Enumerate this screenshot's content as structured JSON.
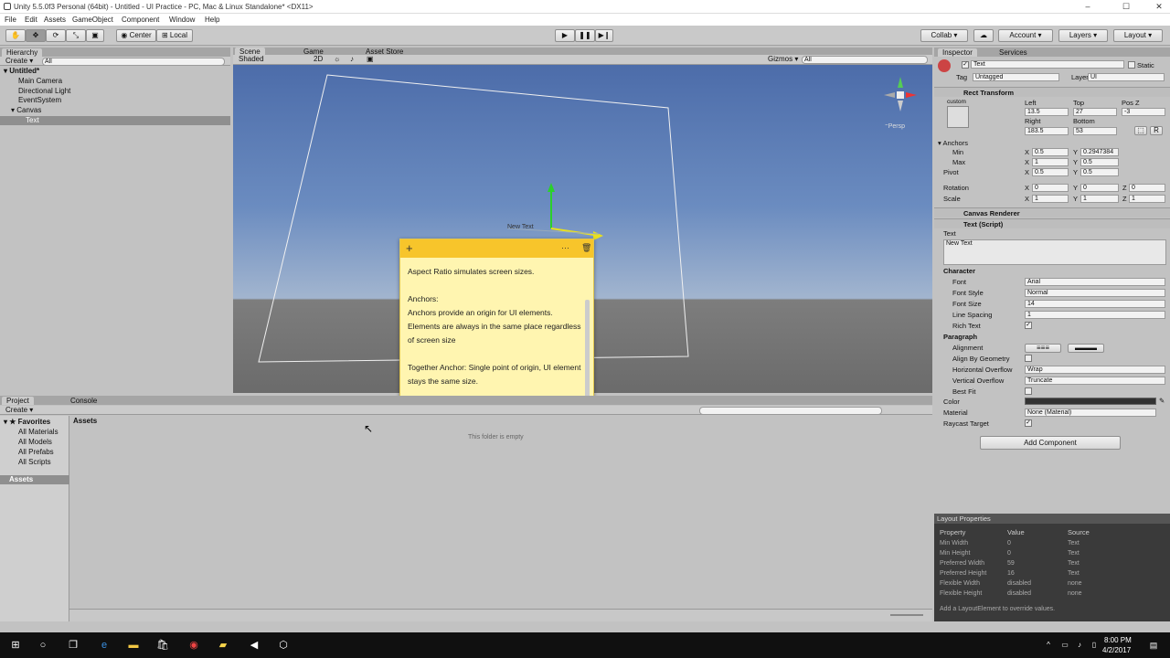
{
  "window": {
    "title": "Unity 5.5.0f3 Personal (64bit) - Untitled - UI Practice - PC, Mac & Linux Standalone* <DX11>"
  },
  "menu": [
    "File",
    "Edit",
    "Assets",
    "GameObject",
    "Component",
    "Window",
    "Help"
  ],
  "toolbar": {
    "pivot_center": "Center",
    "pivot_local": "Local",
    "collab": "Collab ▾",
    "account": "Account",
    "layers": "Layers",
    "layout": "Layout"
  },
  "hierarchy": {
    "tab": "Hierarchy",
    "create": "Create ▾",
    "search_placeholder": "All",
    "scene": "Untitled*",
    "items": [
      "Main Camera",
      "Directional Light",
      "EventSystem",
      "Canvas",
      "Text"
    ]
  },
  "scene_view": {
    "tabs": [
      "Scene",
      "Game",
      "Asset Store"
    ],
    "shading": "Shaded",
    "mode_2d": "2D",
    "gizmos": "Gizmos ▾",
    "search_placeholder": "All",
    "persp_label": "Persp",
    "object_label": "New Text"
  },
  "sticky_note": {
    "text": "Aspect Ratio simulates screen sizes.\n\nAnchors:\nAnchors provide an origin for UI elements. Elements are always in the same place regardless of screen size\n\nTogether Anchor: Single point of origin, UI element stays the same size.\n\nSplit Anchors: Organize UI elements inside a zone, resi"
  },
  "project": {
    "tabs": [
      "Project",
      "Console"
    ],
    "create": "Create ▾",
    "favorites_label": "Favorites",
    "favorites": [
      "All Materials",
      "All Models",
      "All Prefabs",
      "All Scripts"
    ],
    "assets_label": "Assets",
    "breadcrumb": "Assets",
    "empty_text": "This folder is empty"
  },
  "inspector": {
    "tabs": [
      "Inspector",
      "Services"
    ],
    "object_name": "Text",
    "static_label": "Static",
    "tag_label": "Tag",
    "tag_value": "Untagged",
    "layer_label": "Layer",
    "layer_value": "UI",
    "rect_transform": {
      "title": "Rect Transform",
      "custom": "custom",
      "left_label": "Left",
      "left": "13.5",
      "top_label": "Top",
      "top": "27",
      "posz_label": "Pos Z",
      "posz": "-3",
      "right_label": "Right",
      "right": "183.5",
      "bottom_label": "Bottom",
      "bottom": "53",
      "r_button": "R",
      "anchors_label": "Anchors",
      "min_label": "Min",
      "min_x": "0.5",
      "min_y": "0.2947384",
      "max_label": "Max",
      "max_x": "1",
      "max_y": "0.5",
      "pivot_label": "Pivot",
      "pivot_x": "0.5",
      "pivot_y": "0.5",
      "rotation_label": "Rotation",
      "rot_x": "0",
      "rot_y": "0",
      "rot_z": "0",
      "scale_label": "Scale",
      "scale_x": "1",
      "scale_y": "1",
      "scale_z": "1",
      "x": "X",
      "y": "Y",
      "z": "Z"
    },
    "canvas_renderer": {
      "title": "Canvas Renderer"
    },
    "text_script": {
      "title": "Text (Script)",
      "text_label": "Text",
      "text_value": "New Text",
      "character_label": "Character",
      "font_label": "Font",
      "font_value": "Arial",
      "font_style_label": "Font Style",
      "font_style_value": "Normal",
      "font_size_label": "Font Size",
      "font_size_value": "14",
      "line_spacing_label": "Line Spacing",
      "line_spacing_value": "1",
      "rich_text_label": "Rich Text",
      "paragraph_label": "Paragraph",
      "alignment_label": "Alignment",
      "align_geom_label": "Align By Geometry",
      "hoverflow_label": "Horizontal Overflow",
      "hoverflow_value": "Wrap",
      "voverflow_label": "Vertical Overflow",
      "voverflow_value": "Truncate",
      "best_fit_label": "Best Fit",
      "color_label": "Color",
      "material_label": "Material",
      "material_value": "None (Material)",
      "raycast_label": "Raycast Target"
    },
    "add_component": "Add Component"
  },
  "layout_properties": {
    "title": "Layout Properties",
    "headers": [
      "Property",
      "Value",
      "Source"
    ],
    "rows": [
      [
        "Min Width",
        "0",
        "Text"
      ],
      [
        "Min Height",
        "0",
        "Text"
      ],
      [
        "Preferred Width",
        "59",
        "Text"
      ],
      [
        "Preferred Height",
        "16",
        "Text"
      ],
      [
        "Flexible Width",
        "disabled",
        "none"
      ],
      [
        "Flexible Height",
        "disabled",
        "none"
      ]
    ],
    "footer": "Add a LayoutElement to override values."
  },
  "taskbar": {
    "time": "8:00 PM",
    "date": "4/2/2017"
  }
}
